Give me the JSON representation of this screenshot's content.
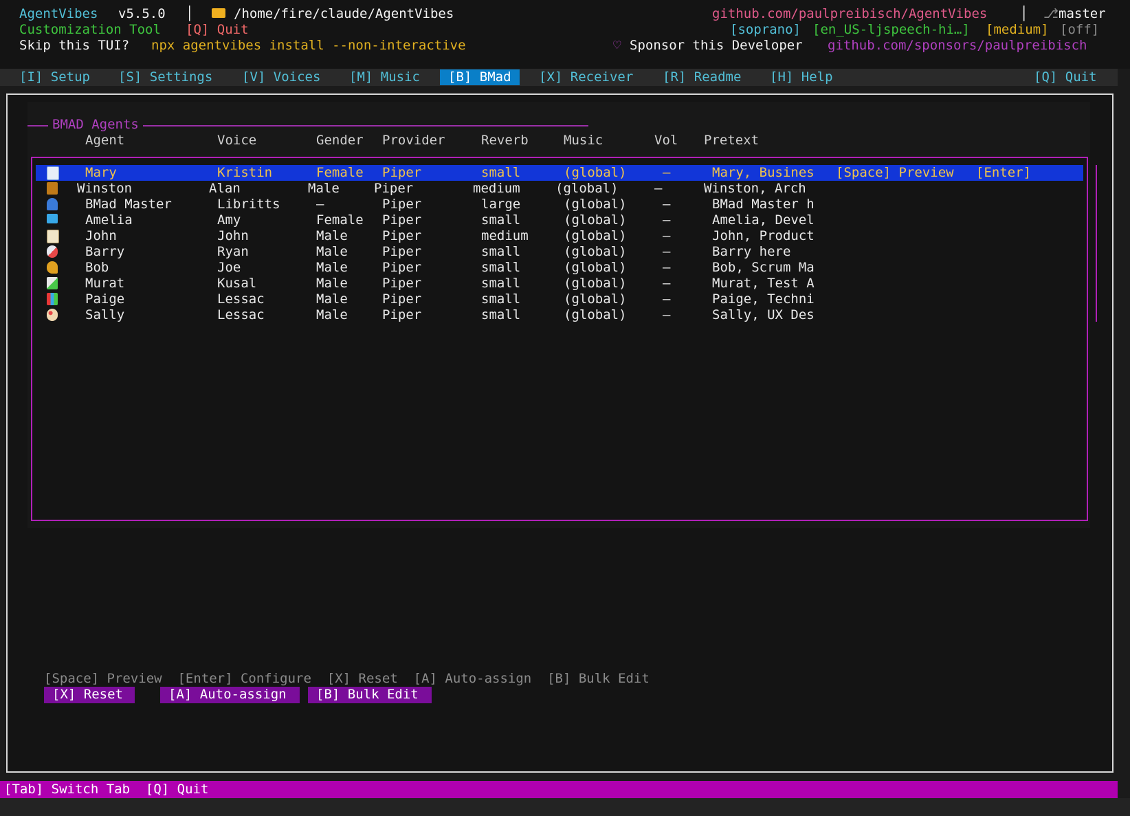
{
  "header": {
    "app_name": "AgentVibes",
    "version": "v5.5.0",
    "separator": "│",
    "path": "/home/fire/claude/AgentVibes",
    "repo_url": "github.com/paulpreibisch/AgentVibes",
    "branch": "master",
    "subtitle": "Customization Tool",
    "quit_hint": "[Q] Quit",
    "status_voice": "[soprano]",
    "status_model": "[en_US-ljspeech-hi…]",
    "status_quality": "[medium]",
    "status_off": "[off]",
    "skip_label": "Skip this TUI?",
    "skip_command": "npx agentvibes install --non-interactive",
    "sponsor_label": "Sponsor this Developer",
    "sponsor_url": "github.com/sponsors/paulpreibisch"
  },
  "tabs": [
    {
      "label": "[I] Setup"
    },
    {
      "label": "[S] Settings"
    },
    {
      "label": "[V] Voices"
    },
    {
      "label": "[M] Music"
    },
    {
      "label": "[B] BMad"
    },
    {
      "label": "[X] Receiver"
    },
    {
      "label": "[R] Readme"
    },
    {
      "label": "[H] Help"
    }
  ],
  "tab_quit": "[Q] Quit",
  "panel": {
    "title": "BMAD Agents",
    "columns": {
      "agent": "Agent",
      "voice": "Voice",
      "gender": "Gender",
      "provider": "Provider",
      "reverb": "Reverb",
      "music": "Music",
      "vol": "Vol",
      "pretext": "Pretext"
    },
    "selected_extra": {
      "preview": "[Space] Preview",
      "enter": "[Enter]"
    },
    "rows": [
      {
        "icon": "bar-chart-icon",
        "agent": "Mary",
        "voice": "Kristin",
        "gender": "Female",
        "provider": "Piper",
        "reverb": "small",
        "music": "(global)",
        "vol": "—",
        "pretext": "Mary, Busines"
      },
      {
        "icon": "construction-icon",
        "agent": "Winston",
        "voice": "Alan",
        "gender": "Male",
        "provider": "Piper",
        "reverb": "medium",
        "music": "(global)",
        "vol": "—",
        "pretext": "Winston, Arch"
      },
      {
        "icon": "mage-icon",
        "agent": "BMad Master",
        "voice": "Libritts",
        "gender": "—",
        "provider": "Piper",
        "reverb": "large",
        "music": "(global)",
        "vol": "—",
        "pretext": "BMad Master h"
      },
      {
        "icon": "laptop-icon",
        "agent": "Amelia",
        "voice": "Amy",
        "gender": "Female",
        "provider": "Piper",
        "reverb": "small",
        "music": "(global)",
        "vol": "—",
        "pretext": "Amelia, Devel"
      },
      {
        "icon": "clipboard-icon",
        "agent": "John",
        "voice": "John",
        "gender": "Male",
        "provider": "Piper",
        "reverb": "medium",
        "music": "(global)",
        "vol": "—",
        "pretext": "John, Product"
      },
      {
        "icon": "rocket-icon",
        "agent": "Barry",
        "voice": "Ryan",
        "gender": "Male",
        "provider": "Piper",
        "reverb": "small",
        "music": "(global)",
        "vol": "—",
        "pretext": "Barry here"
      },
      {
        "icon": "runner-icon",
        "agent": "Bob",
        "voice": "Joe",
        "gender": "Male",
        "provider": "Piper",
        "reverb": "small",
        "music": "(global)",
        "vol": "—",
        "pretext": "Bob, Scrum Ma"
      },
      {
        "icon": "test-tube-icon",
        "agent": "Murat",
        "voice": "Kusal",
        "gender": "Male",
        "provider": "Piper",
        "reverb": "small",
        "music": "(global)",
        "vol": "—",
        "pretext": "Murat, Test A"
      },
      {
        "icon": "books-icon",
        "agent": "Paige",
        "voice": "Lessac",
        "gender": "Male",
        "provider": "Piper",
        "reverb": "small",
        "music": "(global)",
        "vol": "—",
        "pretext": "Paige, Techni"
      },
      {
        "icon": "palette-icon",
        "agent": "Sally",
        "voice": "Lessac",
        "gender": "Male",
        "provider": "Piper",
        "reverb": "small",
        "music": "(global)",
        "vol": "—",
        "pretext": "Sally, UX Des"
      }
    ]
  },
  "hints": "[Space] Preview  [Enter] Configure  [X] Reset  [A] Auto-assign  [B] Bulk Edit",
  "action_buttons": {
    "reset": "[X] Reset",
    "auto_assign": "[A] Auto-assign",
    "bulk_edit": "[B] Bulk Edit"
  },
  "statusbar": "[Tab] Switch Tab  [Q] Quit",
  "colors": {
    "accent_magenta": "#b000b0",
    "tab_active": "#0a7fc8",
    "selection": "#1236d8",
    "action_button": "#7a0d9a"
  }
}
